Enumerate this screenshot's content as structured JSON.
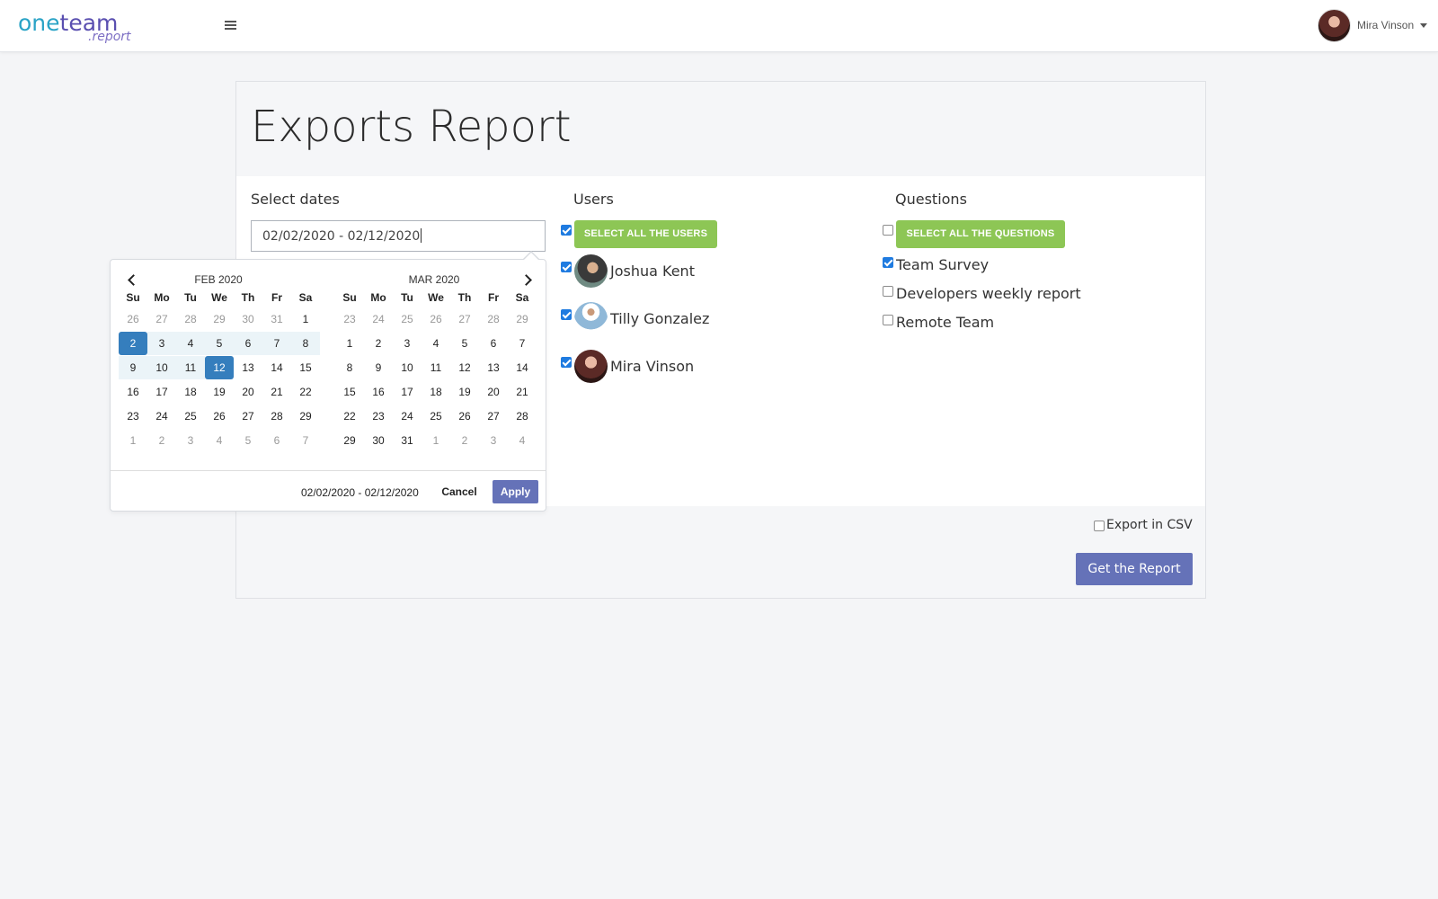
{
  "header": {
    "logo_main_a": "one",
    "logo_main_b": "team",
    "logo_sub": ".report",
    "user_name": "Mira Vinson",
    "menu_icon": "hamburger-icon",
    "dropdown_icon": "caret-down-icon"
  },
  "page": {
    "title": "Exports Report"
  },
  "dates": {
    "label": "Select dates",
    "value": "02/02/2020 - 02/12/2020"
  },
  "users": {
    "label": "Users",
    "select_all_label": "SELECT ALL THE USERS",
    "select_all_checked": true,
    "items": [
      {
        "name": "Joshua Kent",
        "checked": true
      },
      {
        "name": "Tilly Gonzalez",
        "checked": true
      },
      {
        "name": "Mira Vinson",
        "checked": true
      }
    ]
  },
  "questions": {
    "label": "Questions",
    "select_all_label": "SELECT ALL THE QUESTIONS",
    "select_all_checked": false,
    "items": [
      {
        "name": "Team Survey",
        "checked": true
      },
      {
        "name": "Developers weekly report",
        "checked": false
      },
      {
        "name": "Remote Team",
        "checked": false
      }
    ]
  },
  "export": {
    "csv_label": "Export in CSV",
    "csv_checked": false,
    "get_report_label": "Get the Report"
  },
  "datepicker": {
    "weekdays": [
      "Su",
      "Mo",
      "Tu",
      "We",
      "Th",
      "Fr",
      "Sa"
    ],
    "months": [
      {
        "title": "FEB 2020",
        "weeks": [
          [
            "26",
            "27",
            "28",
            "29",
            "30",
            "31",
            "1"
          ],
          [
            "2",
            "3",
            "4",
            "5",
            "6",
            "7",
            "8"
          ],
          [
            "9",
            "10",
            "11",
            "12",
            "13",
            "14",
            "15"
          ],
          [
            "16",
            "17",
            "18",
            "19",
            "20",
            "21",
            "22"
          ],
          [
            "23",
            "24",
            "25",
            "26",
            "27",
            "28",
            "29"
          ],
          [
            "1",
            "2",
            "3",
            "4",
            "5",
            "6",
            "7"
          ]
        ],
        "off": [
          [
            0,
            0
          ],
          [
            0,
            1
          ],
          [
            0,
            2
          ],
          [
            0,
            3
          ],
          [
            0,
            4
          ],
          [
            0,
            5
          ],
          [
            5,
            0
          ],
          [
            5,
            1
          ],
          [
            5,
            2
          ],
          [
            5,
            3
          ],
          [
            5,
            4
          ],
          [
            5,
            5
          ],
          [
            5,
            6
          ]
        ]
      },
      {
        "title": "MAR 2020",
        "weeks": [
          [
            "23",
            "24",
            "25",
            "26",
            "27",
            "28",
            "29"
          ],
          [
            "1",
            "2",
            "3",
            "4",
            "5",
            "6",
            "7"
          ],
          [
            "8",
            "9",
            "10",
            "11",
            "12",
            "13",
            "14"
          ],
          [
            "15",
            "16",
            "17",
            "18",
            "19",
            "20",
            "21"
          ],
          [
            "22",
            "23",
            "24",
            "25",
            "26",
            "27",
            "28"
          ],
          [
            "29",
            "30",
            "31",
            "1",
            "2",
            "3",
            "4"
          ]
        ],
        "off": [
          [
            0,
            0
          ],
          [
            0,
            1
          ],
          [
            0,
            2
          ],
          [
            0,
            3
          ],
          [
            0,
            4
          ],
          [
            0,
            5
          ],
          [
            0,
            6
          ],
          [
            5,
            3
          ],
          [
            5,
            4
          ],
          [
            5,
            5
          ],
          [
            5,
            6
          ]
        ]
      }
    ],
    "selected_start": "2",
    "selected_end": "12",
    "range_text": "02/02/2020 - 02/12/2020",
    "cancel_label": "Cancel",
    "apply_label": "Apply",
    "accent_color": "#357ebd",
    "range_color": "#ebf4f8"
  },
  "colors": {
    "green": "#8dc655",
    "primary": "#6572b8",
    "checkbox": "#1f7be0"
  }
}
